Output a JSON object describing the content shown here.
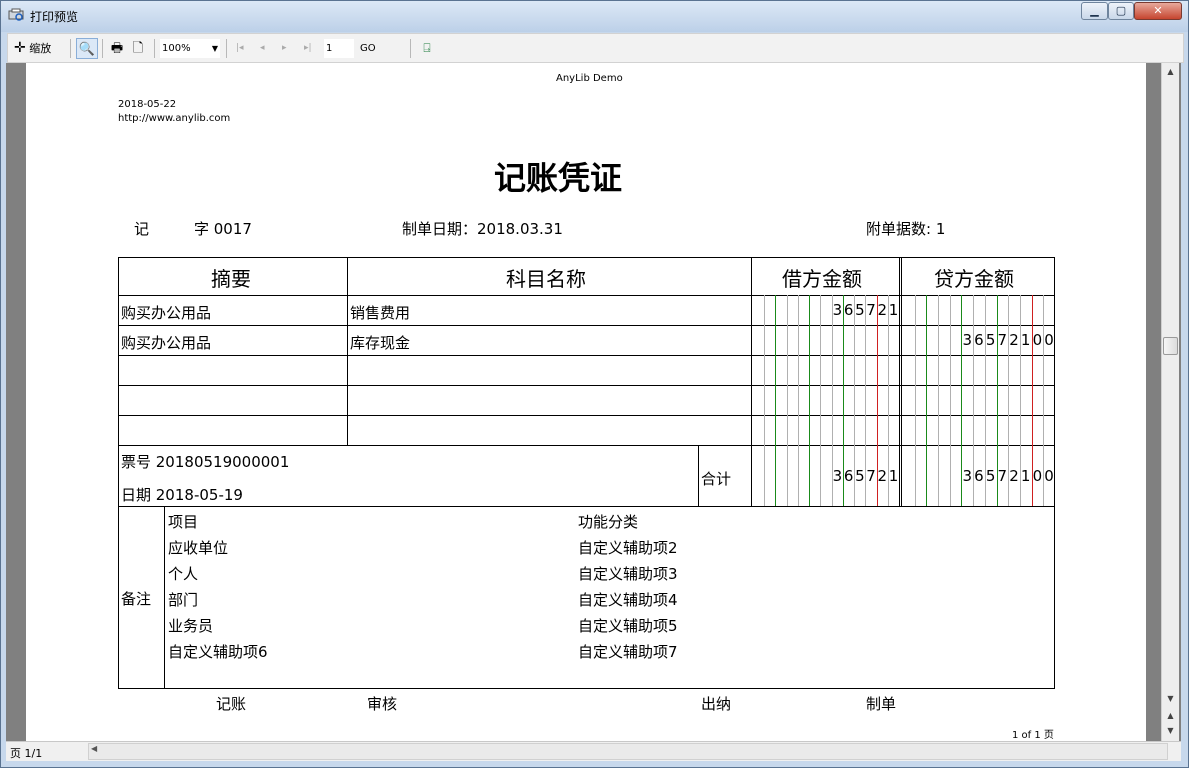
{
  "window": {
    "title": "打印预览",
    "min": "▁",
    "max": "▢",
    "close": "✕"
  },
  "toolbar": {
    "zoom_tool_label": "缩放",
    "zoom_value": "100%",
    "page_input": "1",
    "go_label": "GO"
  },
  "doc": {
    "header_center": "AnyLib Demo",
    "date": "2018-05-22",
    "url": "http://www.anylib.com",
    "title": "记账凭证",
    "ji": "记",
    "zi": "字 0017",
    "make_date_label": "制单日期：2018.03.31",
    "attach_label": "附单据数:  1",
    "col_summary": "摘要",
    "col_account": "科目名称",
    "col_debit": "借方金额",
    "col_credit": "贷方金额",
    "rows": [
      {
        "summary": "购买办公用品",
        "account": "销售费用",
        "debit": "365721",
        "credit": ""
      },
      {
        "summary": "购买办公用品",
        "account": "库存现金",
        "debit": "",
        "credit": "36572100"
      }
    ],
    "ticket_label": "票号  20180519000001",
    "date_label": "日期  2018-05-19",
    "total_label": "合计",
    "total_debit": "365721",
    "total_credit": "36572100",
    "remark_label": "备注",
    "remark_left": [
      "项目",
      "应收单位",
      "个人",
      "部门",
      "业务员",
      "自定义辅助项6"
    ],
    "remark_right": [
      "功能分类",
      "自定义辅助项2",
      "自定义辅助项3",
      "自定义辅助项4",
      "自定义辅助项5",
      "自定义辅助项7"
    ],
    "sign_bookkeep": "记账",
    "sign_review": "审核",
    "sign_cashier": "出纳",
    "sign_maker": "制单",
    "page_footer": "1 of 1 页"
  },
  "status": {
    "page_text": "页  1/1"
  }
}
